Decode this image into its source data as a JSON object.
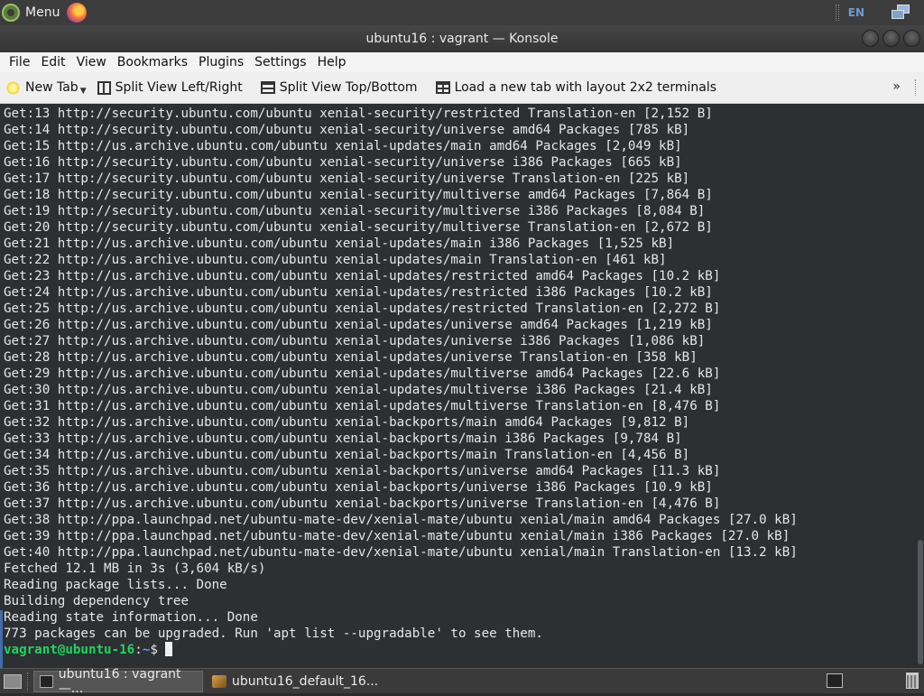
{
  "top_panel": {
    "menu_label": "Menu",
    "keyboard_layout": "EN"
  },
  "window": {
    "title": "ubuntu16 : vagrant — Konsole"
  },
  "menubar": {
    "items": [
      "File",
      "Edit",
      "View",
      "Bookmarks",
      "Plugins",
      "Settings",
      "Help"
    ]
  },
  "toolbar": {
    "new_tab": "New Tab",
    "split_lr": "Split View Left/Right",
    "split_tb": "Split View Top/Bottom",
    "layout_2x2": "Load a new tab with layout 2x2 terminals",
    "overflow": "»"
  },
  "terminal": {
    "lines": [
      "Get:13 http://security.ubuntu.com/ubuntu xenial-security/restricted Translation-en [2,152 B]",
      "Get:14 http://security.ubuntu.com/ubuntu xenial-security/universe amd64 Packages [785 kB]",
      "Get:15 http://us.archive.ubuntu.com/ubuntu xenial-updates/main amd64 Packages [2,049 kB]",
      "Get:16 http://security.ubuntu.com/ubuntu xenial-security/universe i386 Packages [665 kB]",
      "Get:17 http://security.ubuntu.com/ubuntu xenial-security/universe Translation-en [225 kB]",
      "Get:18 http://security.ubuntu.com/ubuntu xenial-security/multiverse amd64 Packages [7,864 B]",
      "Get:19 http://security.ubuntu.com/ubuntu xenial-security/multiverse i386 Packages [8,084 B]",
      "Get:20 http://security.ubuntu.com/ubuntu xenial-security/multiverse Translation-en [2,672 B]",
      "Get:21 http://us.archive.ubuntu.com/ubuntu xenial-updates/main i386 Packages [1,525 kB]",
      "Get:22 http://us.archive.ubuntu.com/ubuntu xenial-updates/main Translation-en [461 kB]",
      "Get:23 http://us.archive.ubuntu.com/ubuntu xenial-updates/restricted amd64 Packages [10.2 kB]",
      "Get:24 http://us.archive.ubuntu.com/ubuntu xenial-updates/restricted i386 Packages [10.2 kB]",
      "Get:25 http://us.archive.ubuntu.com/ubuntu xenial-updates/restricted Translation-en [2,272 B]",
      "Get:26 http://us.archive.ubuntu.com/ubuntu xenial-updates/universe amd64 Packages [1,219 kB]",
      "Get:27 http://us.archive.ubuntu.com/ubuntu xenial-updates/universe i386 Packages [1,086 kB]",
      "Get:28 http://us.archive.ubuntu.com/ubuntu xenial-updates/universe Translation-en [358 kB]",
      "Get:29 http://us.archive.ubuntu.com/ubuntu xenial-updates/multiverse amd64 Packages [22.6 kB]",
      "Get:30 http://us.archive.ubuntu.com/ubuntu xenial-updates/multiverse i386 Packages [21.4 kB]",
      "Get:31 http://us.archive.ubuntu.com/ubuntu xenial-updates/multiverse Translation-en [8,476 B]",
      "Get:32 http://us.archive.ubuntu.com/ubuntu xenial-backports/main amd64 Packages [9,812 B]",
      "Get:33 http://us.archive.ubuntu.com/ubuntu xenial-backports/main i386 Packages [9,784 B]",
      "Get:34 http://us.archive.ubuntu.com/ubuntu xenial-backports/main Translation-en [4,456 B]",
      "Get:35 http://us.archive.ubuntu.com/ubuntu xenial-backports/universe amd64 Packages [11.3 kB]",
      "Get:36 http://us.archive.ubuntu.com/ubuntu xenial-backports/universe i386 Packages [10.9 kB]",
      "Get:37 http://us.archive.ubuntu.com/ubuntu xenial-backports/universe Translation-en [4,476 B]",
      "Get:38 http://ppa.launchpad.net/ubuntu-mate-dev/xenial-mate/ubuntu xenial/main amd64 Packages [27.0 kB]",
      "Get:39 http://ppa.launchpad.net/ubuntu-mate-dev/xenial-mate/ubuntu xenial/main i386 Packages [27.0 kB]",
      "Get:40 http://ppa.launchpad.net/ubuntu-mate-dev/xenial-mate/ubuntu xenial/main Translation-en [13.2 kB]",
      "Fetched 12.1 MB in 3s (3,604 kB/s)",
      "Reading package lists... Done",
      "Building dependency tree",
      "Reading state information... Done",
      "773 packages can be upgraded. Run 'apt list --upgradable' to see them."
    ],
    "prompt_user": "vagrant@ubuntu-16",
    "prompt_sep": ":",
    "prompt_path": "~",
    "prompt_symbol": "$ "
  },
  "taskbar": {
    "tasks": [
      {
        "label": "ubuntu16 : vagrant —...",
        "active": true
      },
      {
        "label": "ubuntu16_default_16...",
        "active": false
      }
    ]
  }
}
